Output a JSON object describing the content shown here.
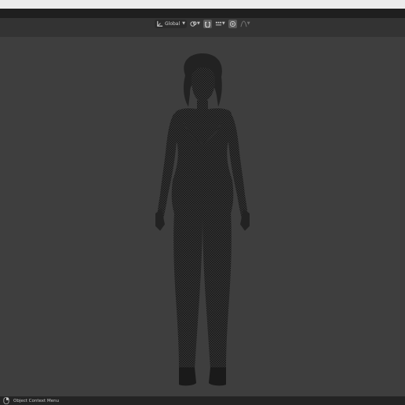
{
  "header": {
    "transform_orientation_label": "Global"
  },
  "toolbar_icons": [
    "transform-orientation-icon",
    "pivot-point-icon",
    "snap-toggle-icon",
    "snap-element-icon",
    "proportional-editing-icon",
    "falloff-curve-icon"
  ],
  "status_bar": {
    "context_menu_label": "Object Context Menu",
    "mouse_icon": "mouse-right-click-icon"
  },
  "colors": {
    "viewport_bg": "#3e3e3e",
    "header_bg": "#333333",
    "mesh_dark": "#1c1c1c",
    "wire": "#4a4a4a"
  }
}
